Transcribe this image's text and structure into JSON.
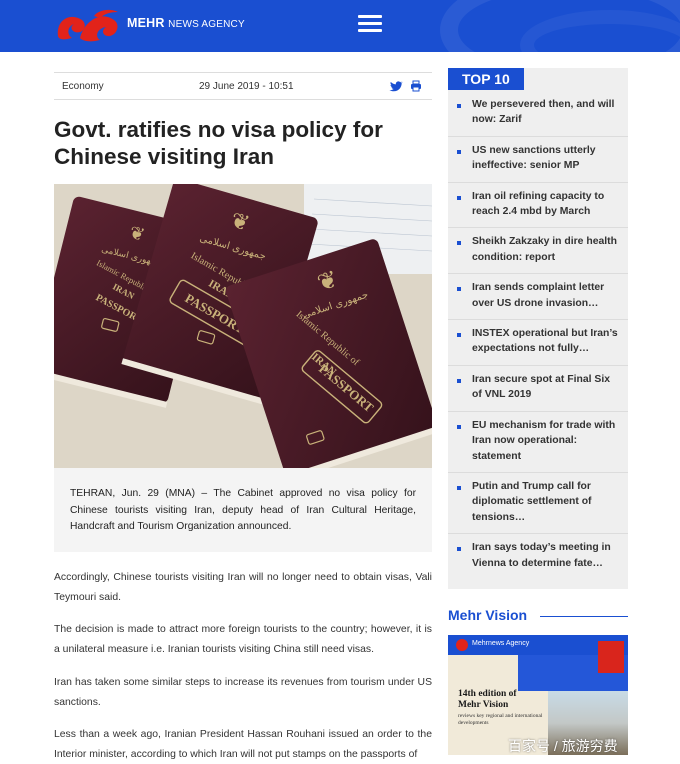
{
  "header": {
    "brand_bold": "MEHR",
    "brand_rest": "NEWS AGENCY",
    "menu_icon": "hamburger-menu-icon",
    "bg_color": "#1a4fd1"
  },
  "article": {
    "category": "Economy",
    "date": "29 June 2019 - 10:51",
    "share_icons": [
      "twitter-icon",
      "print-icon"
    ],
    "title": "Govt. ratifies no visa policy for Chinese visiting Iran",
    "lead": "TEHRAN, Jun. 29 (MNA) – The Cabinet approved no visa policy for Chinese tourists visiting Iran, deputy head of Iran Cultural Heritage, Handcraft and Tourism Organization announced.",
    "paragraphs": [
      "Accordingly, Chinese tourists visiting Iran will no longer need to obtain visas, Vali Teymouri said.",
      "The decision is made to attract more foreign tourists to the country; however, it is a unilateral measure i.e. Iranian tourists visiting China still need visas.",
      "Iran has taken some similar steps to increase its revenues from tourism under US sanctions.",
      "Less than a week ago, Iranian President Hassan Rouhani issued an order to the Interior minister, according to which Iran will not put stamps on the passports of"
    ],
    "image_text": {
      "emblem_script": "جمهوری اسلامی",
      "line1": "Islamic Republic of",
      "line2": "IRAN",
      "line3": "PASSPORT"
    }
  },
  "sidebar": {
    "top10_label": "TOP 10",
    "items": [
      "We persevered then, and will now: Zarif",
      "US new sanctions utterly ineffective: senior MP",
      "Iran oil refining capacity to reach 2.4 mbd by March",
      "Sheikh Zakzaky in dire health condition: report",
      "Iran sends complaint letter over US drone invasion…",
      "INSTEX operational but Iran’s expectations not fully…",
      "Iran secure spot at Final Six of VNL 2019",
      "EU mechanism for trade with Iran now operational: statement",
      "Putin and Trump call for diplomatic settlement of tensions…",
      "Iran says today’s meeting in Vienna to determine fate…"
    ],
    "vision_title": "Mehr Vision",
    "vision_card": {
      "brand": "Mehrnews Agency",
      "edition_line1": "14th edition of",
      "edition_line2": "Mehr Vision",
      "subtitle": "reviews key regional and international developments"
    }
  },
  "overlay": {
    "watermark": "百家号 / 旅游穷费"
  },
  "colors": {
    "accent": "#1a4fd1",
    "passport": "#4a1a24",
    "gold": "#c9b27a"
  }
}
